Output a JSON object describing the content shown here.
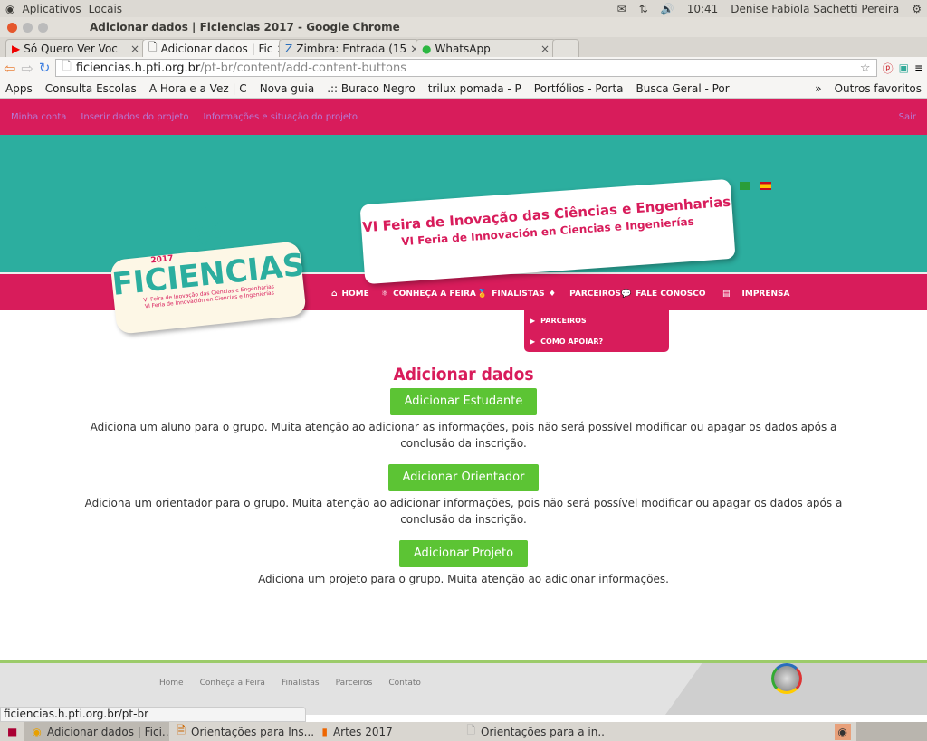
{
  "os": {
    "menu": [
      "Aplicativos",
      "Locais"
    ],
    "time": "10:41",
    "user": "Denise Fabiola Sachetti Pereira"
  },
  "window": {
    "title": "Adicionar dados | Ficiencias 2017 - Google Chrome"
  },
  "tabs": [
    {
      "label": "Só Quero Ver Voc"
    },
    {
      "label": "Adicionar dados | Fic"
    },
    {
      "label": "Zimbra: Entrada (15"
    },
    {
      "label": "WhatsApp"
    }
  ],
  "address": {
    "host": "ficiencias.h.pti.org.br",
    "path": "/pt-br/content/add-content-buttons"
  },
  "bookmarks": [
    "Apps",
    "Consulta Escolas",
    "A Hora e a Vez | C",
    "Nova guia",
    ".:: Buraco Negro",
    "trilux pomada - P",
    "Portfólios - Porta",
    "Busca Geral - Por",
    "»",
    "Outros favoritos"
  ],
  "admin": {
    "links": [
      "Minha conta",
      "Inserir dados do projeto",
      "Informações e situação do projeto"
    ],
    "logout": "Sair"
  },
  "banner": {
    "logo_year": "2017",
    "logo_name": "FICIENCIAS",
    "logo_sub1": "VI Feira de Inovação das Ciências e Engenharias",
    "logo_sub2": "VI Feria de Innovación en Ciencias e Ingenierías",
    "slogan1": "VI Feira de Inovação das Ciências e Engenharias",
    "slogan2": "VI Feria de Innovación en Ciencias e Ingenierías"
  },
  "nav": [
    {
      "label": "HOME",
      "icon": "home-icon"
    },
    {
      "label": "CONHEÇA A FEIRA",
      "icon": "atom-icon"
    },
    {
      "label": "FINALISTAS",
      "icon": "medal-icon"
    },
    {
      "label": "PARCEIROS",
      "icon": "tie-icon"
    },
    {
      "label": "FALE CONOSCO",
      "icon": "chat-icon"
    },
    {
      "label": "IMPRENSA",
      "icon": "document-icon"
    }
  ],
  "dropdown": [
    "PARCEIROS",
    "COMO APOIAR?"
  ],
  "main": {
    "title": "Adicionar dados",
    "items": [
      {
        "button": "Adicionar Estudante",
        "desc1": "Adiciona um aluno para o grupo. Muita atenção ao adicionar as informações, pois não será possível modificar ou apagar os dados após a",
        "desc2": "conclusão da inscrição."
      },
      {
        "button": "Adicionar Orientador",
        "desc1": "Adiciona um orientador para o grupo. Muita atenção ao adicionar informações, pois não será possível modificar ou apagar os dados após a",
        "desc2": "conclusão da inscrição."
      },
      {
        "button": "Adicionar Projeto",
        "desc1": "Adiciona um projeto para o grupo. Muita atenção ao adicionar informações.",
        "desc2": ""
      }
    ]
  },
  "footer": {
    "links": [
      "Home",
      "Conheça a Feira",
      "Finalistas",
      "Parceiros",
      "Contato"
    ]
  },
  "status_url": "ficiencias.h.pti.org.br/pt-br",
  "taskbar": [
    "Adicionar dados | Fici...",
    "Orientações para Ins...",
    "Artes  2017",
    "Orientações para a in..."
  ],
  "colors": {
    "brand_pink": "#d81c5b",
    "teal": "#2cae9f",
    "button_green": "#5cc434"
  }
}
